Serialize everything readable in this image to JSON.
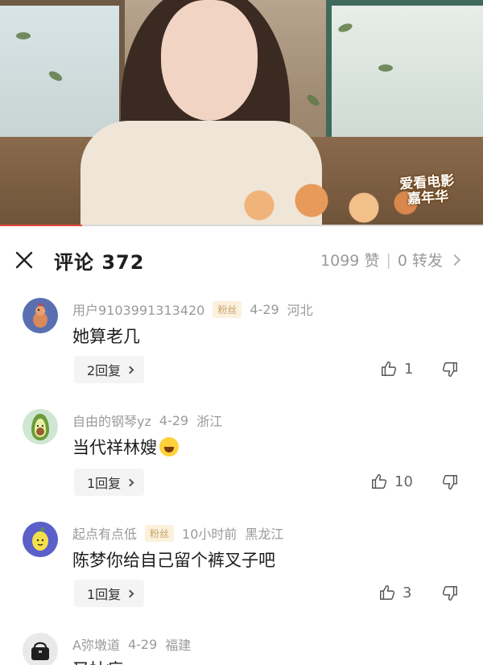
{
  "video": {
    "watermark_line1": "爱看电影",
    "watermark_line2": "嘉年华",
    "progress": 0.17
  },
  "header": {
    "title": "评论 372",
    "likes": "1099 赞",
    "separator": "|",
    "shares": "0 转发"
  },
  "comments": [
    {
      "username": "用户9103991313420",
      "badge": "粉丝",
      "date": "4-29",
      "region": "河北",
      "text": "她算老几",
      "reply_label": "2回复",
      "like_count": "1",
      "avatar_icon": "rooster-avatar"
    },
    {
      "username": "自由的钢琴yz",
      "badge": "",
      "date": "4-29",
      "region": "浙江",
      "text": "当代祥林嫂",
      "reply_label": "1回复",
      "like_count": "10",
      "avatar_icon": "avocado-avatar"
    },
    {
      "username": "起点有点低",
      "badge": "粉丝",
      "date": "10小时前",
      "region": "黑龙江",
      "text": "陈梦你给自己留个裤叉子吧",
      "reply_label": "1回复",
      "like_count": "3",
      "avatar_icon": "lemon-avatar"
    },
    {
      "username": "A弥墩道",
      "badge": "",
      "date": "4-29",
      "region": "福建",
      "text": "又抽疯",
      "avatar_icon": "handbag-avatar"
    }
  ],
  "colors": {
    "progress": "#e34a3a",
    "badge_bg": "#fbf1dd",
    "badge_text": "#c9a36a",
    "meta_text": "#9a9a9a"
  }
}
